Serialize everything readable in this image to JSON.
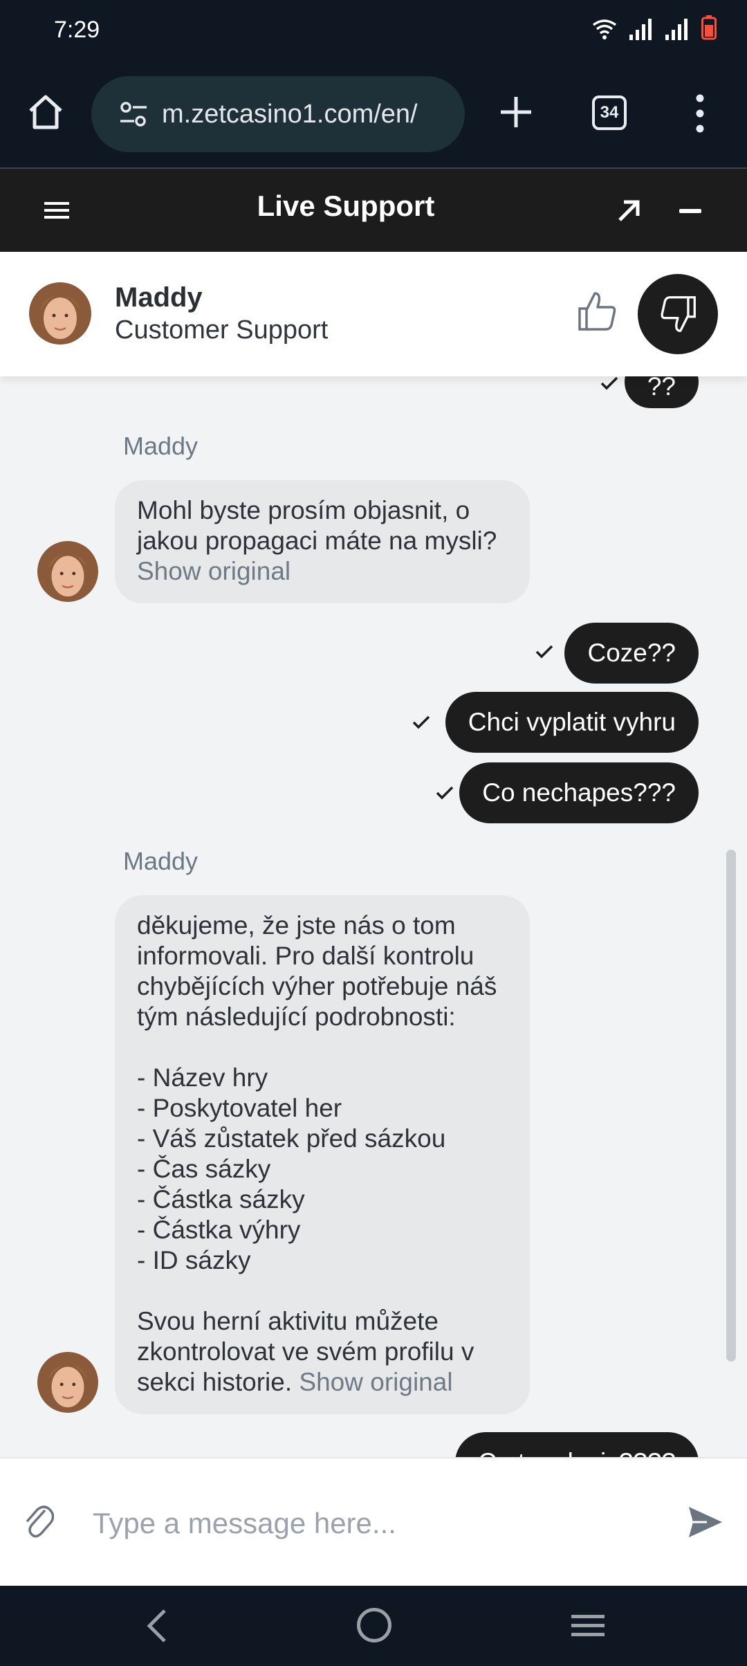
{
  "status_bar": {
    "time": "7:29"
  },
  "browser": {
    "url": "m.zetcasino1.com/en/",
    "tab_count": "34"
  },
  "live_support": {
    "title": "Live Support"
  },
  "agent": {
    "name": "Maddy",
    "role": "Customer Support"
  },
  "chat": {
    "cut_message_top": "??",
    "agent_label_1": "Maddy",
    "agent_message_1": "Mohl byste prosím objasnit, o jakou propagaci máte na mysli?",
    "show_original": "Show original",
    "user_messages": [
      "Coze??",
      "Chci vyplatit vyhru",
      "Co nechapes???"
    ],
    "agent_label_2": "Maddy",
    "agent_message_2": "děkujeme, že jste nás o tom informovali. Pro další kontrolu chybějících výher potřebuje náš tým následující podrobnosti:\n\n- Název hry\n- Poskytovatel her\n- Váš zůstatek před sázkou\n- Čas sázky\n- Částka sázky\n- Částka výhry\n- ID sázky\n\nSvou herní aktivitu můžete zkontrolovat ve svém profilu v sekci historie.",
    "cut_message_bottom": "Co to mluvis????"
  },
  "composer": {
    "placeholder": "Type a message here..."
  },
  "colors": {
    "dark_bubble": "#1d1d1d",
    "light_bubble": "#e6e8ea",
    "header_bg": "#1c1c1c",
    "system_bar_bg": "#0e1722"
  }
}
